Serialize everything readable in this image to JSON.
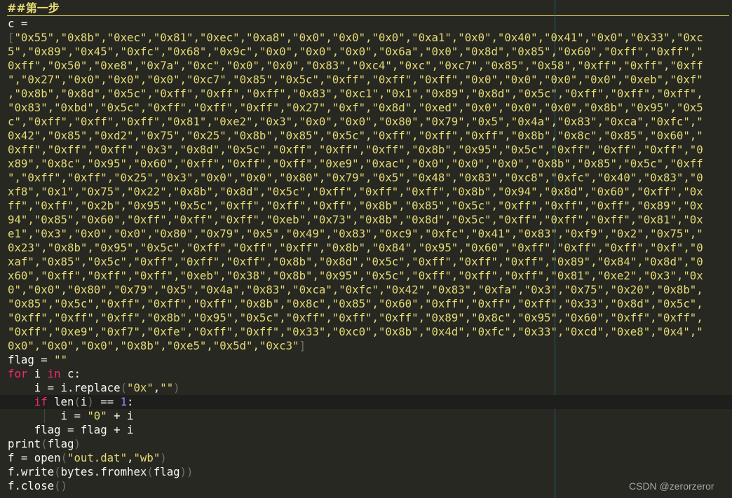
{
  "editor": {
    "heading": "##第一步",
    "lines": {
      "l1": "c =",
      "l2_open": "[",
      "l2": "\"0x55\",\"0x8b\",\"0xec\",\"0x81\",\"0xec\",\"0xa8\",\"0x0\",\"0x0\",\"0x0\",\"0xa1\",\"0x0\",\"0x40\",\"0x41\",\"0x0\",\"0x33\",\"0xc",
      "l3": "5\",\"0x89\",\"0x45\",\"0xfc\",\"0x68\",\"0x9c\",\"0x0\",\"0x0\",\"0x0\",\"0x6a\",\"0x0\",\"0x8d\",\"0x85\",\"0x60\",\"0xff\",\"0xff\",\"",
      "l4": "0xff\",\"0x50\",\"0xe8\",\"0x7a\",\"0xc\",\"0x0\",\"0x0\",\"0x83\",\"0xc4\",\"0xc\",\"0xc7\",\"0x85\",\"0x58\",\"0xff\",\"0xff\",\"0xff",
      "l5": "\",\"0x27\",\"0x0\",\"0x0\",\"0x0\",\"0xc7\",\"0x85\",\"0x5c\",\"0xff\",\"0xff\",\"0xff\",\"0x0\",\"0x0\",\"0x0\",\"0x0\",\"0xeb\",\"0xf\"",
      "l6": ",\"0x8b\",\"0x8d\",\"0x5c\",\"0xff\",\"0xff\",\"0xff\",\"0x83\",\"0xc1\",\"0x1\",\"0x89\",\"0x8d\",\"0x5c\",\"0xff\",\"0xff\",\"0xff\",",
      "l7": "\"0x83\",\"0xbd\",\"0x5c\",\"0xff\",\"0xff\",\"0xff\",\"0x27\",\"0xf\",\"0x8d\",\"0xed\",\"0x0\",\"0x0\",\"0x0\",\"0x8b\",\"0x95\",\"0x5",
      "l8": "c\",\"0xff\",\"0xff\",\"0xff\",\"0x81\",\"0xe2\",\"0x3\",\"0x0\",\"0x0\",\"0x80\",\"0x79\",\"0x5\",\"0x4a\",\"0x83\",\"0xca\",\"0xfc\",\"",
      "l9": "0x42\",\"0x85\",\"0xd2\",\"0x75\",\"0x25\",\"0x8b\",\"0x85\",\"0x5c\",\"0xff\",\"0xff\",\"0xff\",\"0x8b\",\"0x8c\",\"0x85\",\"0x60\",\"",
      "l10": "0xff\",\"0xff\",\"0xff\",\"0x3\",\"0x8d\",\"0x5c\",\"0xff\",\"0xff\",\"0xff\",\"0x8b\",\"0x95\",\"0x5c\",\"0xff\",\"0xff\",\"0xff\",\"0",
      "l11": "x89\",\"0x8c\",\"0x95\",\"0x60\",\"0xff\",\"0xff\",\"0xff\",\"0xe9\",\"0xac\",\"0x0\",\"0x0\",\"0x0\",\"0x8b\",\"0x85\",\"0x5c\",\"0xff",
      "l12": "\",\"0xff\",\"0xff\",\"0x25\",\"0x3\",\"0x0\",\"0x0\",\"0x80\",\"0x79\",\"0x5\",\"0x48\",\"0x83\",\"0xc8\",\"0xfc\",\"0x40\",\"0x83\",\"0",
      "l13": "xf8\",\"0x1\",\"0x75\",\"0x22\",\"0x8b\",\"0x8d\",\"0x5c\",\"0xff\",\"0xff\",\"0xff\",\"0x8b\",\"0x94\",\"0x8d\",\"0x60\",\"0xff\",\"0x",
      "l14": "ff\",\"0xff\",\"0x2b\",\"0x95\",\"0x5c\",\"0xff\",\"0xff\",\"0xff\",\"0x8b\",\"0x85\",\"0x5c\",\"0xff\",\"0xff\",\"0xff\",\"0x89\",\"0x",
      "l15": "94\",\"0x85\",\"0x60\",\"0xff\",\"0xff\",\"0xff\",\"0xeb\",\"0x73\",\"0x8b\",\"0x8d\",\"0x5c\",\"0xff\",\"0xff\",\"0xff\",\"0x81\",\"0x",
      "l16": "e1\",\"0x3\",\"0x0\",\"0x0\",\"0x80\",\"0x79\",\"0x5\",\"0x49\",\"0x83\",\"0xc9\",\"0xfc\",\"0x41\",\"0x83\",\"0xf9\",\"0x2\",\"0x75\",\"",
      "l17": "0x23\",\"0x8b\",\"0x95\",\"0x5c\",\"0xff\",\"0xff\",\"0xff\",\"0x8b\",\"0x84\",\"0x95\",\"0x60\",\"0xff\",\"0xff\",\"0xff\",\"0xf\",\"0",
      "l18": "xaf\",\"0x85\",\"0x5c\",\"0xff\",\"0xff\",\"0xff\",\"0x8b\",\"0x8d\",\"0x5c\",\"0xff\",\"0xff\",\"0xff\",\"0x89\",\"0x84\",\"0x8d\",\"0",
      "l19": "x60\",\"0xff\",\"0xff\",\"0xff\",\"0xeb\",\"0x38\",\"0x8b\",\"0x95\",\"0x5c\",\"0xff\",\"0xff\",\"0xff\",\"0x81\",\"0xe2\",\"0x3\",\"0x",
      "l20": "0\",\"0x0\",\"0x80\",\"0x79\",\"0x5\",\"0x4a\",\"0x83\",\"0xca\",\"0xfc\",\"0x42\",\"0x83\",\"0xfa\",\"0x3\",\"0x75\",\"0x20\",\"0x8b\",",
      "l21": "\"0x85\",\"0x5c\",\"0xff\",\"0xff\",\"0xff\",\"0x8b\",\"0x8c\",\"0x85\",\"0x60\",\"0xff\",\"0xff\",\"0xff\",\"0x33\",\"0x8d\",\"0x5c\",",
      "l22": "\"0xff\",\"0xff\",\"0xff\",\"0x8b\",\"0x95\",\"0x5c\",\"0xff\",\"0xff\",\"0xff\",\"0x89\",\"0x8c\",\"0x95\",\"0x60\",\"0xff\",\"0xff\",",
      "l23": "\"0xff\",\"0xe9\",\"0xf7\",\"0xfe\",\"0xff\",\"0xff\",\"0x33\",\"0xc0\",\"0x8b\",\"0x4d\",\"0xfc\",\"0x33\",\"0xcd\",\"0xe8\",\"0x4\",\"",
      "l24": "0x0\",\"0x0\",\"0x0\",\"0x8b\",\"0xe5\",\"0x5d\",\"0xc3\"",
      "l24_close": "]"
    },
    "tokens": {
      "flag_init": "flag = ",
      "empty_str": "\"\"",
      "kw_for": "for",
      "var_i": " i ",
      "kw_in": "in",
      "for_rest": " c:",
      "replace_pre": "    i = i.replace",
      "lp": "(",
      "rp": ")",
      "str_0x": "\"0x\"",
      "comma": ",",
      "kw_if": "if",
      "len_call": " len",
      "var_i2": "i",
      "eq": " == ",
      "num_1": "1",
      "colon": ":",
      "assign_i": "        i = ",
      "str_0": "\"0\"",
      "plus_i": " + i",
      "flag_concat": "    flag = flag + i",
      "print": "print",
      "flag": "flag",
      "f_open": "f = open",
      "str_file": "\"out.dat\"",
      "str_mode": "\"wb\"",
      "f_write": "f.write",
      "bytes_fromhex": "bytes.fromhex",
      "f_close": "f.close",
      "empty_parens": "()"
    },
    "watermark": "CSDN @zerorzeror"
  },
  "colors": {
    "background": "#272822",
    "text": "#f8f8f2",
    "string": "#e6db74",
    "keyword": "#f92672",
    "number": "#ae81ff",
    "paren": "#75715e"
  }
}
